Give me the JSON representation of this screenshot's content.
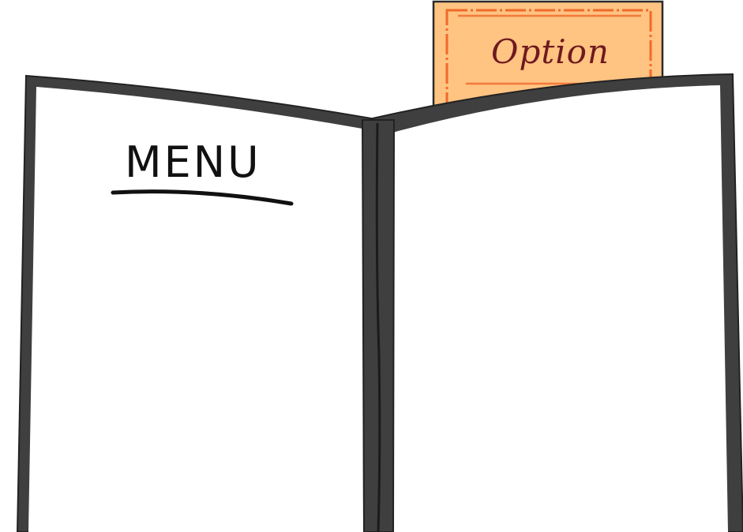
{
  "menu": {
    "title": "MENU"
  },
  "option_card": {
    "label": "Option"
  },
  "colors": {
    "cover": "#3f3f3f",
    "page": "#ffffff",
    "card_fill": "#ffc382",
    "card_border": "#f06a2a",
    "option_text": "#6e1a1e"
  }
}
